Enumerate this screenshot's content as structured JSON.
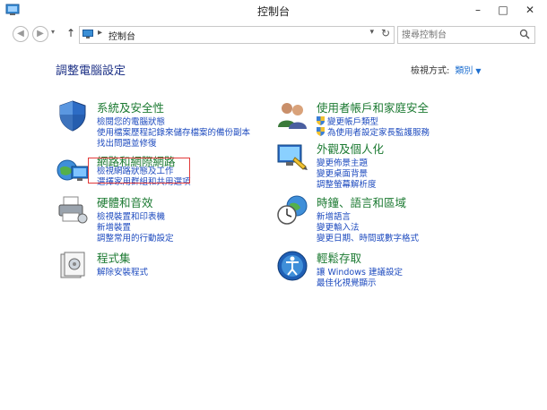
{
  "window": {
    "title": "控制台"
  },
  "titlebar": {
    "min": "–",
    "max": "□",
    "close": "✕"
  },
  "address": {
    "crumb": "控制台",
    "refresh": "↻"
  },
  "search": {
    "placeholder": "搜尋控制台"
  },
  "header": {
    "title": "調整電腦設定",
    "view_by_label": "檢視方式:",
    "view_by_value": "類別"
  },
  "categories": [
    {
      "title": "系統及安全性",
      "icon": "shield-icon",
      "links": [
        "檢閱您的電腦狀態",
        "使用檔案歷程記錄來儲存檔案的備份副本",
        "找出問題並修復"
      ]
    },
    {
      "title": "網路和網際網路",
      "icon": "network-globe-icon",
      "links": [
        "檢視網路狀態及工作",
        "選擇家用群組和共用選項"
      ]
    },
    {
      "title": "硬體和音效",
      "icon": "printer-icon",
      "links": [
        "檢視裝置和印表機",
        "新增裝置",
        "調整常用的行動設定"
      ]
    },
    {
      "title": "程式集",
      "icon": "programs-icon",
      "links": [
        "解除安裝程式"
      ]
    },
    {
      "title": "使用者帳戶和家庭安全",
      "icon": "users-icon",
      "links": [
        "變更帳戶類型",
        "為使用者設定家長監護服務"
      ]
    },
    {
      "title": "外觀及個人化",
      "icon": "monitor-icon",
      "links": [
        "變更佈景主題",
        "變更桌面背景",
        "調整螢幕解析度"
      ]
    },
    {
      "title": "時鐘、語言和區域",
      "icon": "clock-globe-icon",
      "links": [
        "新增語言",
        "變更輸入法",
        "變更日期、時間或數字格式"
      ]
    },
    {
      "title": "輕鬆存取",
      "icon": "ease-of-access-icon",
      "links": [
        "讓 Windows 建議設定",
        "最佳化視覺顯示"
      ]
    }
  ]
}
